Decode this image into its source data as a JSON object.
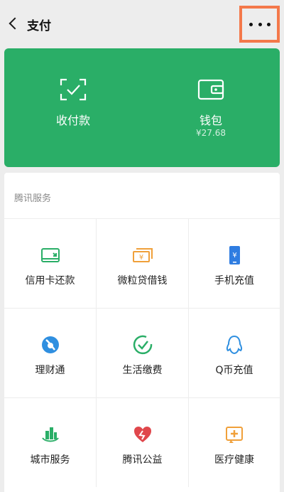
{
  "header": {
    "title": "支付"
  },
  "wallet_panel": {
    "items": [
      {
        "label": "收付款",
        "sub": "",
        "icon": "scan-pay-icon"
      },
      {
        "label": "钱包",
        "sub": "¥27.68",
        "icon": "wallet-icon"
      }
    ]
  },
  "services": {
    "section_title": "腾讯服务",
    "items": [
      {
        "label": "信用卡还款",
        "icon": "credit-card-icon",
        "color": "#2aae67"
      },
      {
        "label": "微粒贷借钱",
        "icon": "cash-stack-icon",
        "color": "#f0a03a"
      },
      {
        "label": "手机充值",
        "icon": "mobile-phone-icon",
        "color": "#2f7de1"
      },
      {
        "label": "理财通",
        "icon": "wealth-icon",
        "color": "#2f8fe0"
      },
      {
        "label": "生活缴费",
        "icon": "checkmark-circle-icon",
        "color": "#2aae67"
      },
      {
        "label": "Q币充值",
        "icon": "qq-penguin-icon",
        "color": "#2f8fe0"
      },
      {
        "label": "城市服务",
        "icon": "city-buildings-icon",
        "color": "#2aae67"
      },
      {
        "label": "腾讯公益",
        "icon": "heart-icon",
        "color": "#e0474c"
      },
      {
        "label": "医疗健康",
        "icon": "medical-box-icon",
        "color": "#f0a03a"
      }
    ]
  }
}
